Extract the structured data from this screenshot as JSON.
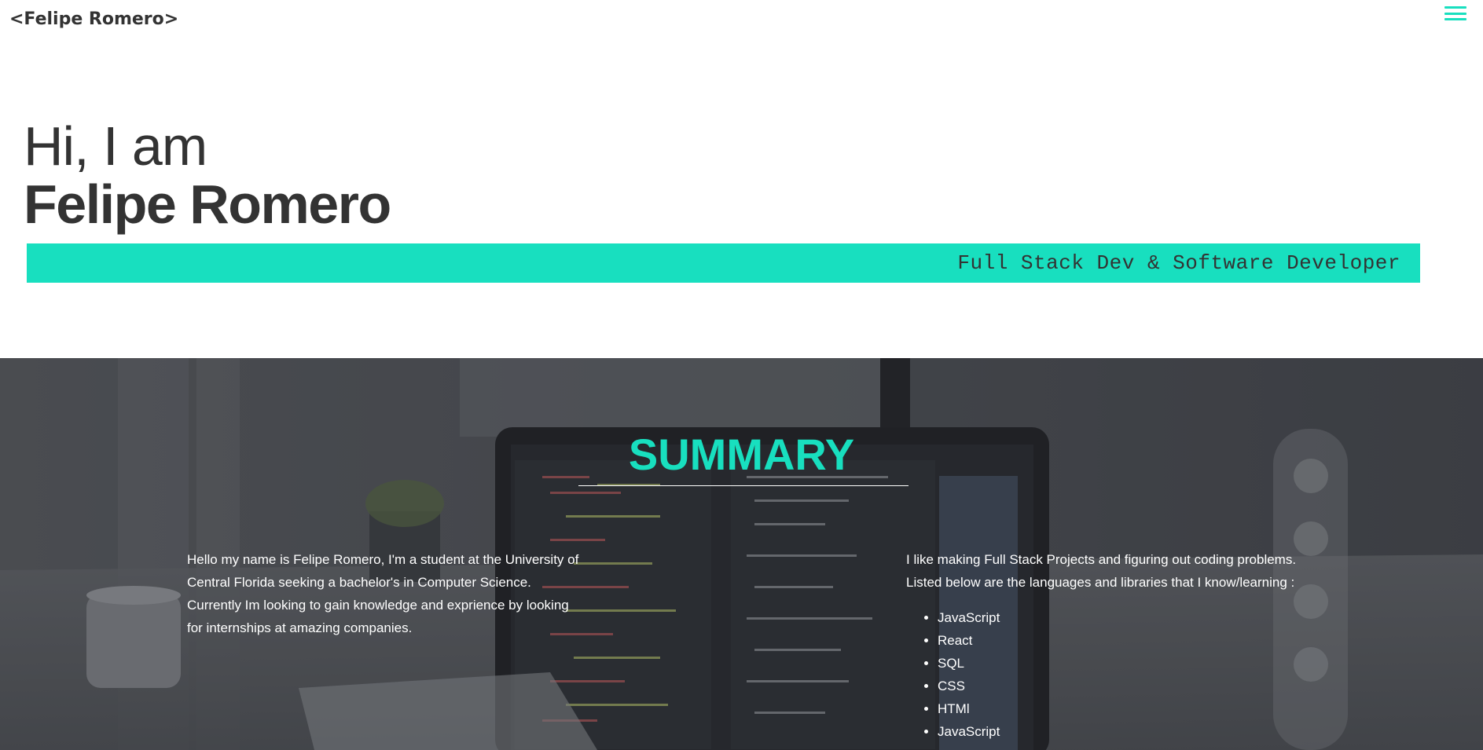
{
  "header": {
    "logo": "<Felipe Romero>",
    "menu_icon": "hamburger-menu-icon",
    "accent_color": "#18dfbf"
  },
  "hero": {
    "greeting": "Hi, I am",
    "name": "Felipe Romero",
    "role": "Full Stack Dev & Software Developer"
  },
  "summary": {
    "title": "SUMMARY",
    "about": "Hello my name is Felipe Romero, I'm a student at the University of Central Florida seeking a bachelor's in Computer Science. Currently Im looking to gain knowledge and exprience by looking for internships at amazing companies.",
    "intro": "I like making Full Stack Projects and figuring out coding problems. Listed below are the languages and libraries that I know/learning :",
    "skills": [
      "JavaScript",
      "React",
      "SQL",
      "CSS",
      "HTMl",
      "JavaScript"
    ]
  }
}
